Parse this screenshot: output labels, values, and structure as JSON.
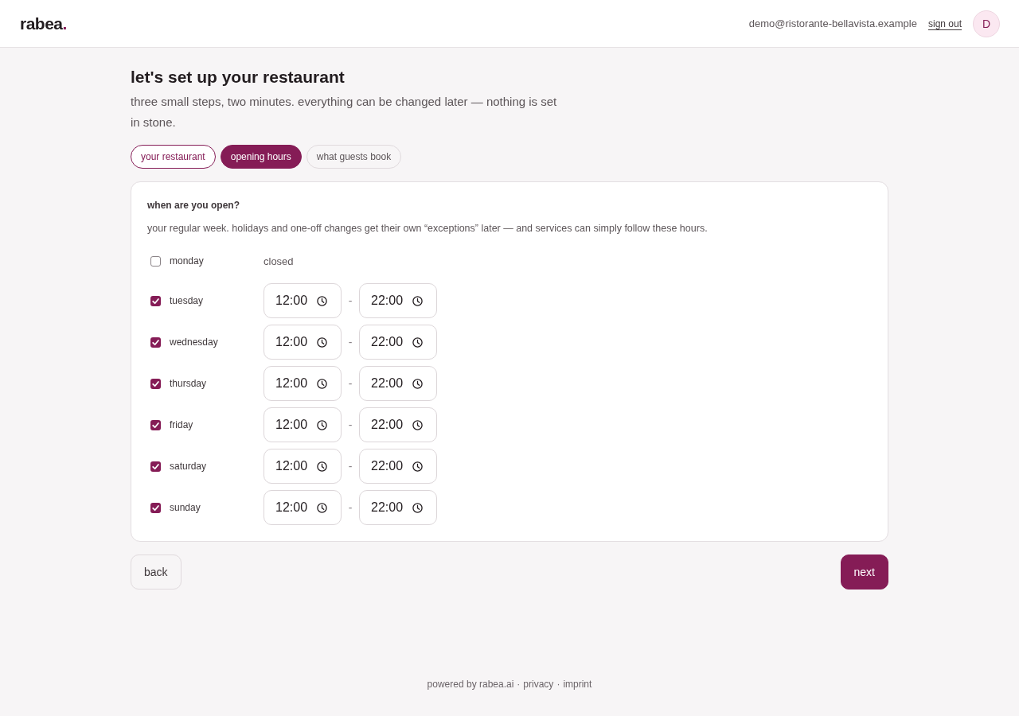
{
  "header": {
    "logo": {
      "text": "rabea",
      "mark": "."
    },
    "email": "demo@ristorante-bellavista.example",
    "sign_out": "sign out",
    "avatar": "D"
  },
  "intro": {
    "title": "let's set up your restaurant",
    "subtitle": "three small steps, two minutes. everything can be changed later — nothing is set in stone."
  },
  "steps": [
    {
      "label": "your restaurant",
      "selected": false,
      "done": true
    },
    {
      "label": "opening hours",
      "selected": true,
      "done": false
    },
    {
      "label": "what guests book",
      "selected": false,
      "done": false
    }
  ],
  "hours": {
    "title": "when are you open?",
    "description": "your regular week. holidays and one-off changes get their own “exceptions” later — and services can simply follow these hours.",
    "days": [
      {
        "name": "monday",
        "checked": false,
        "closed_label": "closed"
      },
      {
        "name": "tuesday",
        "checked": true,
        "from": "12:00",
        "separator": "-",
        "to": "22:00"
      },
      {
        "name": "wednesday",
        "checked": true,
        "from": "12:00",
        "separator": "-",
        "to": "22:00"
      },
      {
        "name": "thursday",
        "checked": true,
        "from": "12:00",
        "separator": "-",
        "to": "22:00"
      },
      {
        "name": "friday",
        "checked": true,
        "from": "12:00",
        "separator": "-",
        "to": "22:00"
      },
      {
        "name": "saturday",
        "checked": true,
        "from": "12:00",
        "separator": "-",
        "to": "22:00"
      },
      {
        "name": "sunday",
        "checked": true,
        "from": "12:00",
        "separator": "-",
        "to": "22:00"
      }
    ]
  },
  "actions": {
    "back": "back",
    "next": "next"
  },
  "footer": {
    "credit": "powered by rabea.ai",
    "links": [
      {
        "separator": "·",
        "label": "privacy"
      },
      {
        "separator": "·",
        "label": "imprint"
      }
    ]
  }
}
